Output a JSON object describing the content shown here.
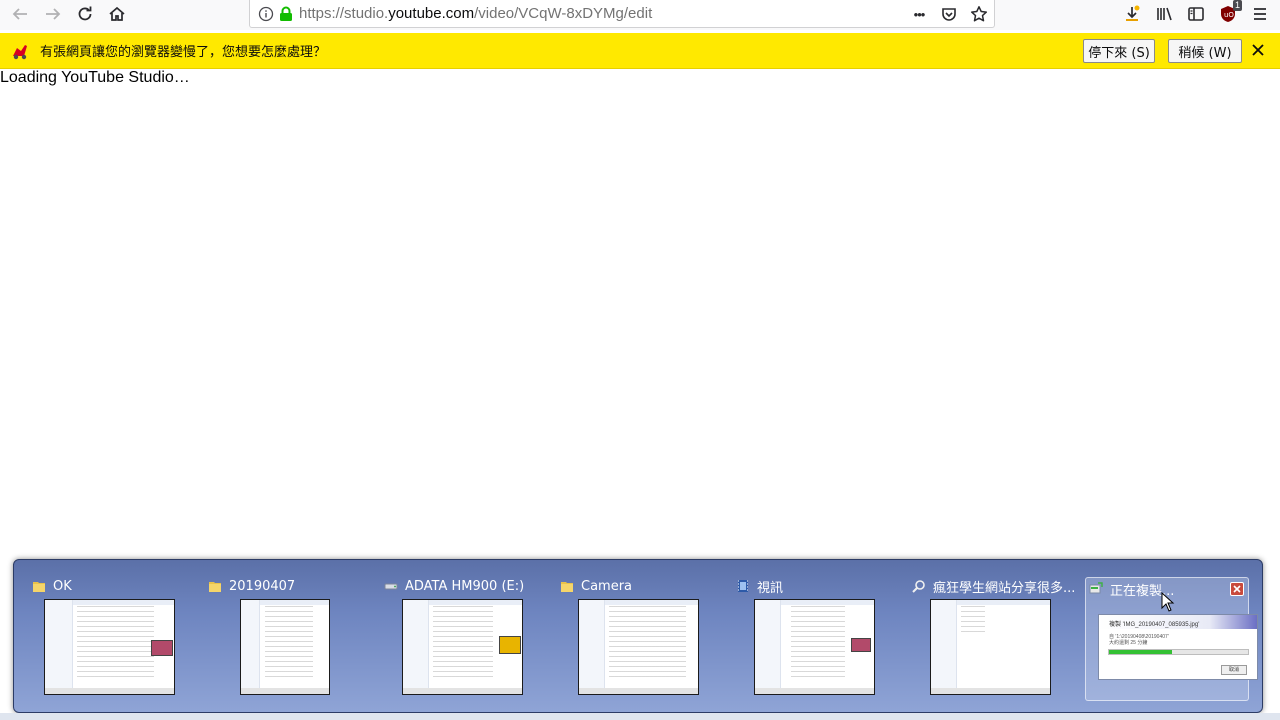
{
  "browser": {
    "url_prefix": "https://studio.",
    "url_domain": "youtube.com",
    "url_suffix": "/video/VCqW-8xDYMg/edit",
    "page_actions_label": "•••",
    "library_badge": "1"
  },
  "notification": {
    "message": "有張網頁讓您的瀏覽器變慢了，您想要怎麼處理？",
    "stop_button": "停下來 (S)",
    "wait_button": "稍候 (W)"
  },
  "page": {
    "loading_text": "Loading YouTube Studio…"
  },
  "taskbar_preview": {
    "windows": [
      {
        "title": "OK",
        "icon": "folder-icon"
      },
      {
        "title": "20190407",
        "icon": "folder-icon"
      },
      {
        "title": "ADATA HM900 (E:)",
        "icon": "drive-icon"
      },
      {
        "title": "Camera",
        "icon": "folder-icon"
      },
      {
        "title": "視訊",
        "icon": "video-folder-icon"
      },
      {
        "title": "瘋狂學生網站分享很多...",
        "icon": "search-icon"
      },
      {
        "title": "正在複製...",
        "icon": "copy-icon"
      }
    ],
    "copy_dialog": {
      "line1": "複製 'IMG_20190407_085935.jpg'",
      "line2": "自 '1:\\20190408\\20190407'",
      "line3": "大約還剩 25 分鐘",
      "cancel": "取消",
      "progress": 0.45
    }
  },
  "colors": {
    "notification_bg": "#ffe900",
    "strip_bg": "#6e85c0",
    "progress_fill": "#34c134"
  }
}
